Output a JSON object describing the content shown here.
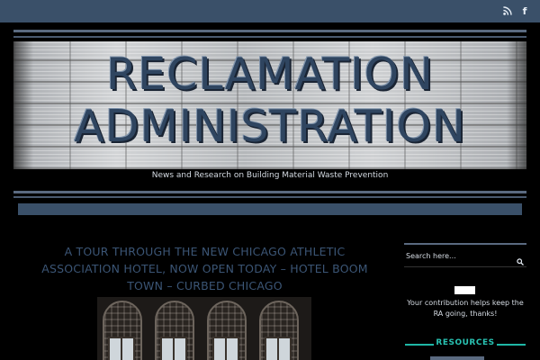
{
  "topbar": {
    "icons": [
      "rss-icon",
      "facebook-icon"
    ],
    "facebook_glyph": "f"
  },
  "site": {
    "title_line1": "RECLAMATION",
    "title_line2": "ADMINISTRATION",
    "tagline": "News and Research on Building Material Waste Prevention"
  },
  "post": {
    "title": "A TOUR THROUGH THE NEW CHICAGO ATHLETIC ASSOCIATION HOTEL, NOW OPEN TODAY – HOTEL BOOM TOWN – CURBED CHICAGO"
  },
  "sidebar": {
    "search": {
      "placeholder": "Search here...",
      "icon": "search-icon"
    },
    "donate": {
      "text": "Your contribution helps keep the RA going, thanks!"
    },
    "resources": {
      "heading": "RESOURCES"
    }
  },
  "colors": {
    "accent_nav": "#3a5069",
    "title_text": "#3b5575",
    "resources_teal": "#29c3b3",
    "background": "#000000"
  }
}
